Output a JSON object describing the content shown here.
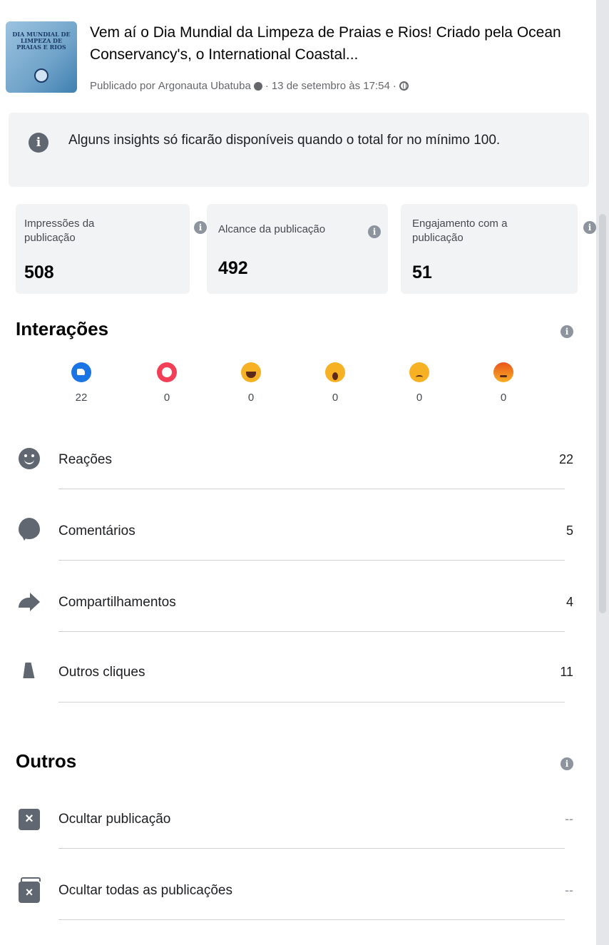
{
  "post": {
    "thumbnail_text": "DIA MUNDIAL DE LIMPEZA DE PRAIAS E RIOS",
    "title": "Vem aí o Dia Mundial da Limpeza de Praias e Rios! Criado pela Ocean Conservancy's, o International Coastal...",
    "meta_prefix": "Publicado por",
    "author": "Argonauta Ubatuba",
    "date": "13 de setembro às 17:54"
  },
  "notice": {
    "text": "Alguns insights só ficarão disponíveis quando o total for no mínimo 100."
  },
  "metrics": [
    {
      "label": "Impressões da publicação",
      "value": "508"
    },
    {
      "label": "Alcance da publicação",
      "value": "492"
    },
    {
      "label": "Engajamento com a publicação",
      "value": "51"
    }
  ],
  "interactions": {
    "title": "Interações",
    "reactions": [
      {
        "name": "like",
        "count": "22"
      },
      {
        "name": "love",
        "count": "0"
      },
      {
        "name": "haha",
        "count": "0"
      },
      {
        "name": "wow",
        "count": "0"
      },
      {
        "name": "sad",
        "count": "0"
      },
      {
        "name": "angry",
        "count": "0"
      }
    ],
    "rows": [
      {
        "icon": "smile-icon",
        "label": "Reações",
        "value": "22"
      },
      {
        "icon": "comment-icon",
        "label": "Comentários",
        "value": "5"
      },
      {
        "icon": "share-icon",
        "label": "Compartilhamentos",
        "value": "4"
      },
      {
        "icon": "cursor-icon",
        "label": "Outros cliques",
        "value": "11"
      }
    ]
  },
  "others": {
    "title": "Outros",
    "rows": [
      {
        "icon": "hide-post-icon",
        "label": "Ocultar publicação",
        "value": "--"
      },
      {
        "icon": "hide-all-posts-icon",
        "label": "Ocultar todas as publicações",
        "value": "--"
      }
    ]
  },
  "colors": {
    "like": "#1b74e4",
    "love": "#f33e58",
    "emoji_yellow": "#f7b125",
    "card_bg": "#f2f3f5",
    "icon_gray": "#606770"
  }
}
